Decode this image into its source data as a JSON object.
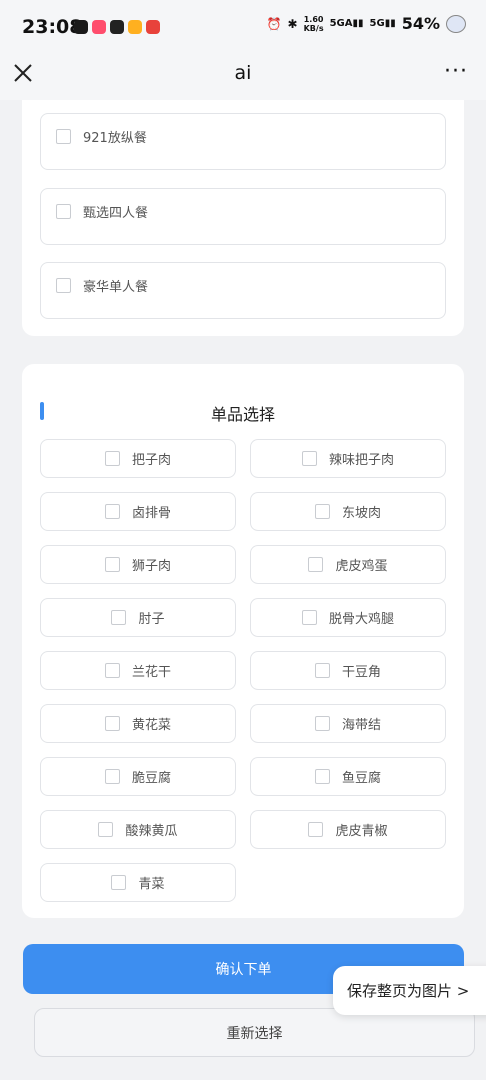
{
  "status": {
    "time": "23:08",
    "speed_value": "1.60",
    "speed_unit": "KB/s",
    "sig1": "5GA",
    "sig2": "5G",
    "battery": "54%"
  },
  "nav": {
    "title": "ai",
    "more": "···"
  },
  "meal_options": [
    {
      "label": "921放纵餐"
    },
    {
      "label": "甄选四人餐"
    },
    {
      "label": "豪华单人餐"
    }
  ],
  "items_section": {
    "title": "单品选择",
    "items": [
      {
        "label": "把子肉"
      },
      {
        "label": "辣味把子肉"
      },
      {
        "label": "卤排骨"
      },
      {
        "label": "东坡肉"
      },
      {
        "label": "狮子肉"
      },
      {
        "label": "虎皮鸡蛋"
      },
      {
        "label": "肘子"
      },
      {
        "label": "脱骨大鸡腿"
      },
      {
        "label": "兰花干"
      },
      {
        "label": "干豆角"
      },
      {
        "label": "黄花菜"
      },
      {
        "label": "海带结"
      },
      {
        "label": "脆豆腐"
      },
      {
        "label": "鱼豆腐"
      },
      {
        "label": "酸辣黄瓜"
      },
      {
        "label": "虎皮青椒"
      },
      {
        "label": "青菜"
      }
    ]
  },
  "buttons": {
    "confirm": "确认下单",
    "reset": "重新选择"
  },
  "save_page": "保存整页为图片 >",
  "colors": {
    "accent": "#3d8ef0"
  }
}
